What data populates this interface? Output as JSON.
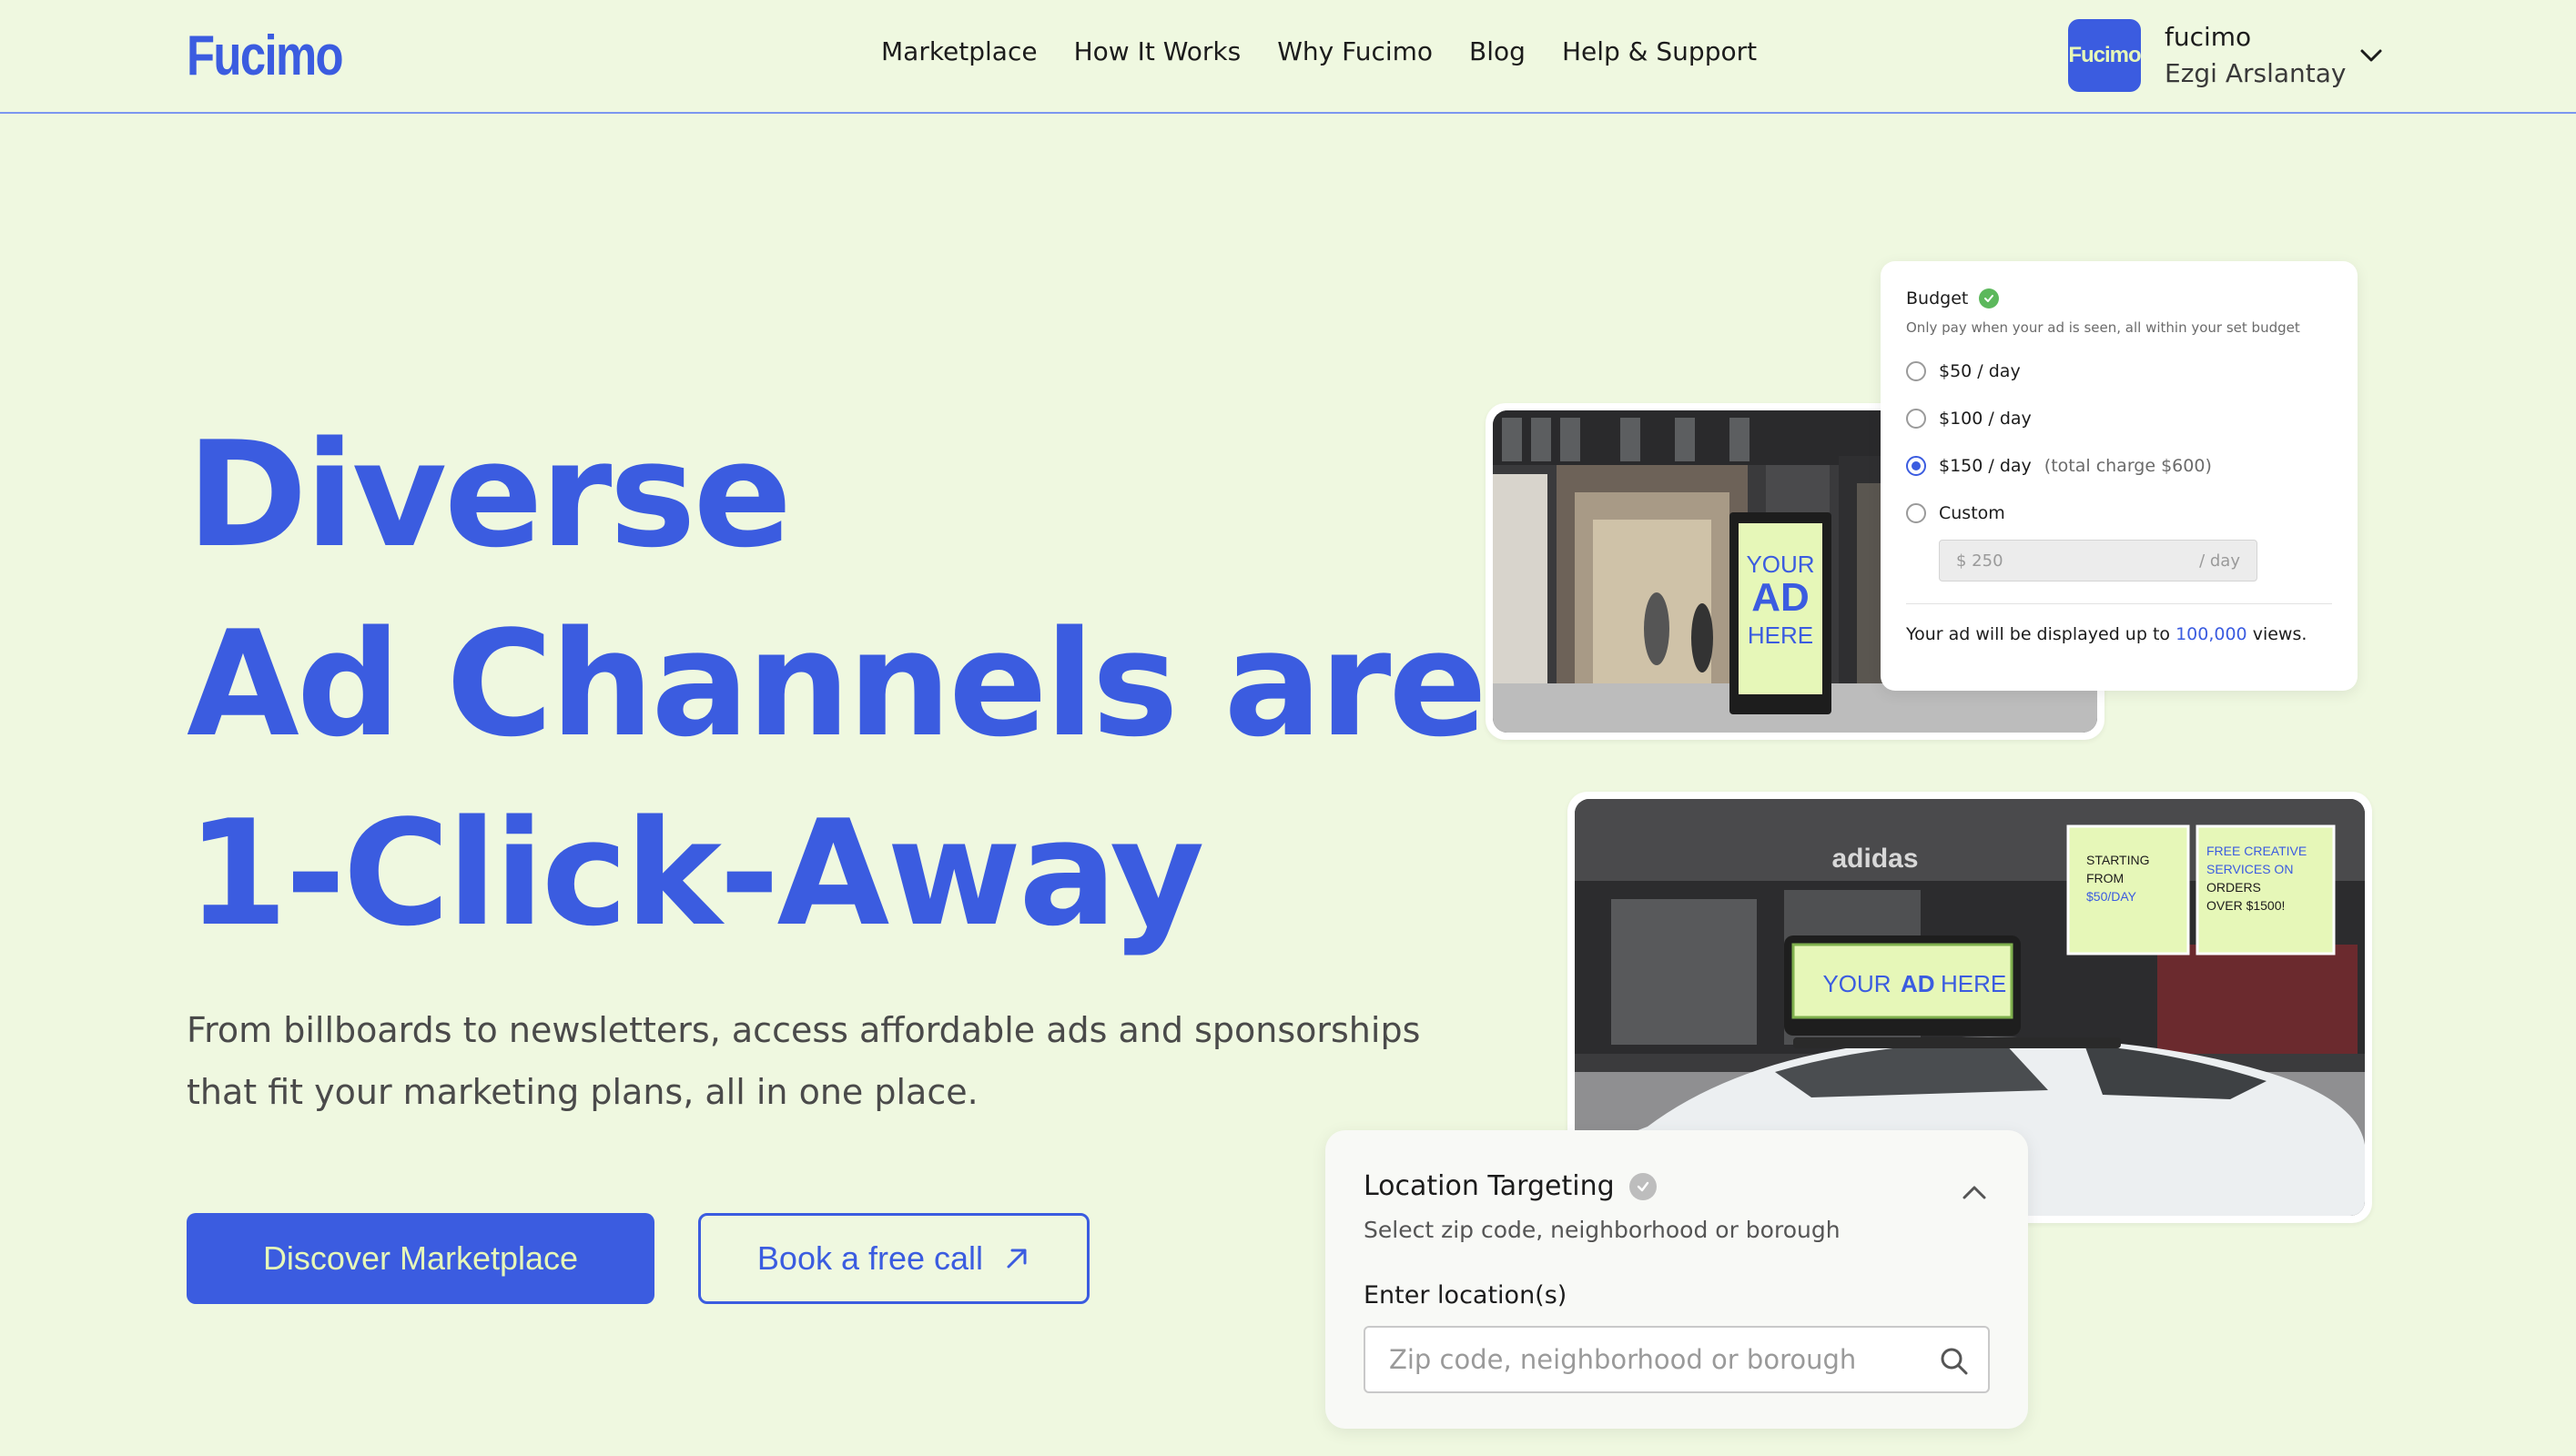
{
  "header": {
    "logo": "Fucimo",
    "nav": [
      "Marketplace",
      "How It Works",
      "Why Fucimo",
      "Blog",
      "Help & Support"
    ],
    "account": {
      "avatar_text": "Fucimo",
      "org": "fucimo",
      "user": "Ezgi Arslantay"
    }
  },
  "hero": {
    "title_lines": [
      "Diverse",
      "Ad Channels are",
      "1-Click-Away"
    ],
    "subtitle_lines": [
      "From billboards to newsletters, access affordable ads and sponsorships",
      "that fit your marketing plans, all in one place."
    ],
    "primary_button": "Discover Marketplace",
    "secondary_button": "Book a free call"
  },
  "photo1": {
    "ad_line1": "YOUR",
    "ad_line2": "AD",
    "ad_line3": "HERE"
  },
  "photo2": {
    "store_sign": "adidas",
    "car_ad_a": "YOUR",
    "car_ad_b": "AD",
    "car_ad_c": "HERE",
    "sign_left": [
      "STARTING",
      "FROM",
      "$50/DAY"
    ],
    "sign_right": [
      "FREE CREATIVE",
      "SERVICES ON",
      "ORDERS",
      "OVER $1500!"
    ]
  },
  "budget": {
    "title": "Budget",
    "description": "Only pay when your ad is seen, all within your set budget",
    "options": [
      {
        "label": "$50 / day",
        "note": ""
      },
      {
        "label": "$100 / day",
        "note": ""
      },
      {
        "label": "$150 / day",
        "note": "(total charge $600)"
      },
      {
        "label": "Custom",
        "note": ""
      }
    ],
    "selected_index": 2,
    "custom_value": "$ 250",
    "custom_unit": "/ day",
    "views_prefix": "Your ad will be displayed up to",
    "views_number": "100,000",
    "views_suffix": "views."
  },
  "location": {
    "title": "Location Targeting",
    "subtitle": "Select zip code, neighborhood or borough",
    "input_label": "Enter location(s)",
    "input_placeholder": "Zip code, neighborhood or borough"
  },
  "colors": {
    "brand_blue": "#3b5ce0",
    "background": "#eff8e0",
    "lime": "#e6f7b8",
    "check_green": "#5cb85c"
  },
  "icons": [
    "chevron-down-icon",
    "arrow-up-right-icon",
    "check-circle-icon",
    "chevron-up-icon",
    "search-icon"
  ]
}
